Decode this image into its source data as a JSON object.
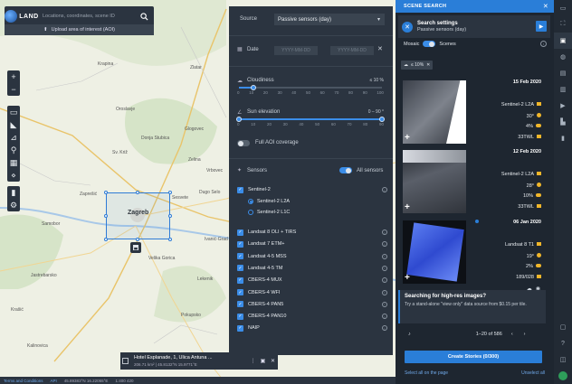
{
  "app": {
    "logo_text": "LAND",
    "search_placeholder": "Locations, coordinates, scene ID",
    "upload_label": "Upload area of interest (AOI)"
  },
  "map": {
    "places": [
      {
        "name": "Zaprešić",
        "big": false
      },
      {
        "name": "Zagreb",
        "big": true
      },
      {
        "name": "Sesvete",
        "big": false
      },
      {
        "name": "Velika Gorica",
        "big": false
      },
      {
        "name": "Samobor",
        "big": false
      },
      {
        "name": "Oroslavje",
        "big": false
      },
      {
        "name": "Krapina",
        "big": false
      },
      {
        "name": "Zlatar",
        "big": false
      },
      {
        "name": "Donja Stubica",
        "big": false
      },
      {
        "name": "Sv. Križ",
        "big": false
      },
      {
        "name": "Glogovec",
        "big": false
      },
      {
        "name": "Dugo Selo",
        "big": false
      },
      {
        "name": "Vrbovec",
        "big": false
      },
      {
        "name": "Zelina",
        "big": false
      },
      {
        "name": "Ivanić-Grad",
        "big": false
      },
      {
        "name": "Lekenik",
        "big": false
      },
      {
        "name": "Jastrebarsko",
        "big": false
      },
      {
        "name": "Pokupsko",
        "big": false
      },
      {
        "name": "Krašić",
        "big": false
      },
      {
        "name": "Kalinovica",
        "big": false
      }
    ],
    "hotel_popup": {
      "title": "Hotel Esplanade, 1, Ulica Antuna ...",
      "subtitle": "206.71 km² | 45.8132°N 15.9771°E"
    },
    "status": {
      "terms": "Terms and Conditions",
      "api": "API",
      "coords": "45.89383°N 16.22055°E",
      "scale": "1:400 420"
    }
  },
  "settings": {
    "source_label": "Source",
    "source_value": "Passive sensors (day)",
    "date_label": "Date",
    "date_from_placeholder": "YYYY-MM-DD",
    "date_to_placeholder": "YYYY-MM-DD",
    "cloudiness_label": "Cloudiness",
    "cloudiness_value": "≤ 10 %",
    "cloud_ticks": [
      "0",
      "10",
      "20",
      "30",
      "40",
      "50",
      "60",
      "70",
      "80",
      "90",
      "100"
    ],
    "sun_label": "Sun elevation",
    "sun_value": "0 – 90 °",
    "sun_ticks": [
      "0",
      "10",
      "20",
      "30",
      "40",
      "50",
      "60",
      "70",
      "80",
      "90"
    ],
    "aoi_coverage_label": "Full AOI coverage",
    "sensors_label": "Sensors",
    "all_sensors_label": "All sensors",
    "sentinel2": "Sentinel-2",
    "l2a": "Sentinel-2 L2A",
    "l1c": "Sentinel-2 L1C",
    "sensors": [
      "Landsat 8 OLI + TIRS",
      "Landsat 7 ETM+",
      "Landsat 4-5 MSS",
      "Landsat 4-5 TM",
      "CBERS-4 MUX",
      "CBERS-4 WFI",
      "CBERS-4 PAN5",
      "CBERS-4 PAN10",
      "NAIP"
    ]
  },
  "results": {
    "title": "SCENE SEARCH",
    "search_settings": "Search settings",
    "search_settings_sub": "Passive sensors (day)",
    "mosaic_label": "Mosaic",
    "scenes_label": "Scenes",
    "chip": "≤ 10%",
    "scenes": [
      {
        "date": "15 Feb 2020",
        "sensor": "Sentinel-2  L2A",
        "sun": "30°",
        "cloud": "4%",
        "tile": "33TWL",
        "color": "#5c6270"
      },
      {
        "date": "12 Feb 2020",
        "sensor": "Sentinel-2  L2A",
        "sun": "28°",
        "cloud": "10%",
        "tile": "33TWL",
        "color": "#4a4f5c"
      },
      {
        "date": "06 Jan 2020",
        "sensor": "Landsat  8  T1",
        "sun": "19°",
        "cloud": "2%",
        "tile": "189/028",
        "color": "#3a5bd8"
      }
    ],
    "promo_title": "Searching for high-res images?",
    "promo_text": "Try a stand-alone \"view only\" data source from $0.15 per tile.",
    "pager": "1–20 of 586",
    "create_button": "Create Stories (0/300)",
    "select_all": "Select all on the page",
    "unselect_all": "Unselect all"
  },
  "colors": {
    "accent": "#2a7ed8",
    "panel": "#2b3440",
    "flag": "#f0b62a"
  }
}
